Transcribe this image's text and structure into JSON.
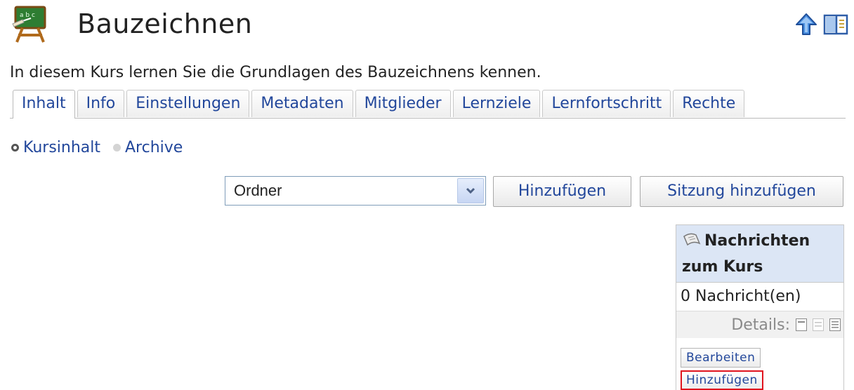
{
  "header": {
    "title": "Bauzeichnen",
    "description": "In diesem Kurs lernen Sie die Grundlagen des Bauzeichnens kennen.",
    "icons": [
      "course-blackboard-icon",
      "up-arrow-icon",
      "layout-toggle-icon"
    ]
  },
  "tabs": [
    {
      "label": "Inhalt",
      "active": true
    },
    {
      "label": "Info",
      "active": false
    },
    {
      "label": "Einstellungen",
      "active": false
    },
    {
      "label": "Metadaten",
      "active": false
    },
    {
      "label": "Mitglieder",
      "active": false
    },
    {
      "label": "Lernziele",
      "active": false
    },
    {
      "label": "Lernfortschritt",
      "active": false
    },
    {
      "label": "Rechte",
      "active": false
    }
  ],
  "subtabs": [
    {
      "label": "Kursinhalt",
      "active": true
    },
    {
      "label": "Archive",
      "active": false
    }
  ],
  "toolbar": {
    "select_value": "Ordner",
    "add_label": "Hinzufügen",
    "add_session_label": "Sitzung hinzufügen"
  },
  "news_block": {
    "title": "Nachrichten zum Kurs",
    "count_text": "0 Nachricht(en)",
    "details_label": "Details:",
    "edit_label": "Bearbeiten",
    "add_label": "Hinzufügen"
  },
  "colors": {
    "link": "#22479b",
    "block_header_bg": "#dce6f5",
    "highlight_border": "#e0141e"
  }
}
